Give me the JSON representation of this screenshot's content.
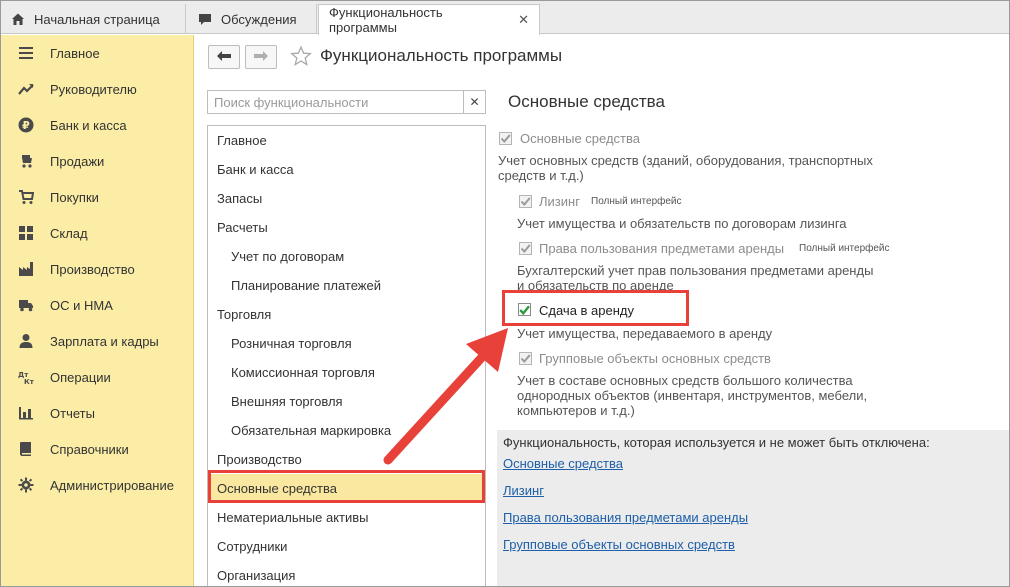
{
  "tabs": [
    {
      "label": "Начальная страница",
      "icon": "home-icon"
    },
    {
      "label": "Обсуждения",
      "icon": "chat-icon"
    },
    {
      "label": "Функциональность программы",
      "icon": ""
    }
  ],
  "sidebar": {
    "items": [
      {
        "label": "Главное",
        "icon": "menu-icon"
      },
      {
        "label": "Руководителю",
        "icon": "trend-icon"
      },
      {
        "label": "Банк и касса",
        "icon": "ruble-icon"
      },
      {
        "label": "Продажи",
        "icon": "cart-icon"
      },
      {
        "label": "Покупки",
        "icon": "basket-icon"
      },
      {
        "label": "Склад",
        "icon": "warehouse-icon"
      },
      {
        "label": "Производство",
        "icon": "factory-icon"
      },
      {
        "label": "ОС и НМА",
        "icon": "truck-icon"
      },
      {
        "label": "Зарплата и кадры",
        "icon": "person-icon"
      },
      {
        "label": "Операции",
        "icon": "dt-kt-icon"
      },
      {
        "label": "Отчеты",
        "icon": "bar-chart-icon"
      },
      {
        "label": "Справочники",
        "icon": "book-icon"
      },
      {
        "label": "Администрирование",
        "icon": "gear-icon"
      }
    ]
  },
  "header": {
    "title": "Функциональность программы"
  },
  "search": {
    "placeholder": "Поиск функциональности",
    "value": ""
  },
  "list": {
    "items": [
      {
        "label": "Главное"
      },
      {
        "label": "Банк и касса"
      },
      {
        "label": "Запасы"
      },
      {
        "label": "Расчеты"
      },
      {
        "label": "Учет по договорам"
      },
      {
        "label": "Планирование платежей"
      },
      {
        "label": "Торговля"
      },
      {
        "label": "Розничная торговля"
      },
      {
        "label": "Комиссионная торговля"
      },
      {
        "label": "Внешняя торговля"
      },
      {
        "label": "Обязательная маркировка"
      },
      {
        "label": "Производство"
      },
      {
        "label": "Основные средства"
      },
      {
        "label": "Нематериальные активы"
      },
      {
        "label": "Сотрудники"
      },
      {
        "label": "Организация"
      }
    ],
    "selected": "Основные средства"
  },
  "content": {
    "title": "Основные средства",
    "options": [
      {
        "label": "Основные средства",
        "checked": true,
        "enabled": false,
        "badge": "",
        "desc": [
          "Учет основных средств (зданий, оборудования, транспортных",
          "средств и т.д.)"
        ]
      },
      {
        "label": "Лизинг",
        "checked": true,
        "enabled": false,
        "badge": "Полный интерфейс",
        "desc": [
          "Учет имущества и обязательств  по договорам лизинга"
        ]
      },
      {
        "label": "Права пользования предметами аренды",
        "checked": true,
        "enabled": false,
        "badge": "Полный интерфейс",
        "desc": [
          "Бухгалтерский учет прав пользования предметами аренды",
          "и обязательств по аренде"
        ]
      },
      {
        "label": "Сдача в аренду",
        "checked": true,
        "enabled": true,
        "badge": "",
        "desc": [
          "Учет имущества, передаваемого в аренду"
        ]
      },
      {
        "label": "Групповые объекты основных средств",
        "checked": true,
        "enabled": false,
        "badge": "",
        "desc": [
          "Учет в составе основных средств большого количества",
          "однородных объектов (инвентаря, инструментов, мебели,",
          "компьютеров и т.д.)"
        ]
      }
    ]
  },
  "info": {
    "title": "Функциональность, которая используется и не может быть отключена:",
    "links": [
      "Основные средства",
      "Лизинг",
      "Права пользования предметами аренды",
      "Групповые объекты основных средств"
    ]
  },
  "colors": {
    "sidebar_bg": "#fbeda6",
    "selected_row": "#fbe8a0",
    "highlight_red": "#e8413a",
    "checkbox_green": "#2e9b3e",
    "link_blue": "#1d5fa8"
  }
}
